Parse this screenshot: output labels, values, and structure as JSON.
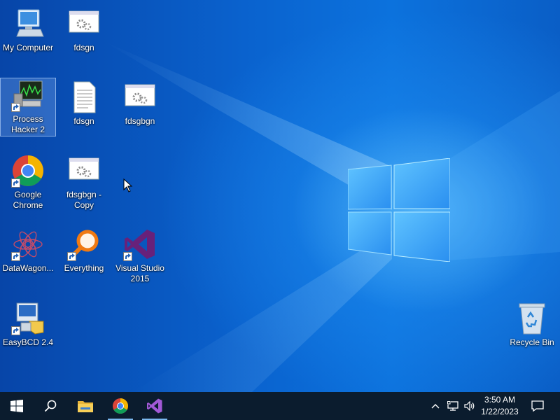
{
  "desktop": {
    "icons": [
      {
        "label": "My Computer",
        "icon": "computer-icon"
      },
      {
        "label": "fdsgn",
        "icon": "application-icon"
      },
      {
        "label": "Process Hacker 2",
        "icon": "process-hacker-icon"
      },
      {
        "label": "fdsgn",
        "icon": "document-icon"
      },
      {
        "label": "fdsgbgn",
        "icon": "application-icon"
      },
      {
        "label": "Google Chrome",
        "icon": "chrome-icon"
      },
      {
        "label": "fdsgbgn - Copy",
        "icon": "application-icon"
      },
      {
        "label": "DataWagon...",
        "icon": "datawagon-icon"
      },
      {
        "label": "Everything",
        "icon": "everything-icon"
      },
      {
        "label": "Visual Studio 2015",
        "icon": "visual-studio-icon"
      },
      {
        "label": "EasyBCD 2.4",
        "icon": "easybcd-icon"
      },
      {
        "label": "Recycle Bin",
        "icon": "recycle-bin-icon"
      }
    ],
    "selected_icon": "Process Hacker 2",
    "wallpaper_logo": "windows-logo"
  },
  "taskbar": {
    "start": "start-icon",
    "search": "search-icon",
    "pinned": [
      "file-explorer-icon",
      "chrome-icon",
      "visual-studio-icon"
    ],
    "tray": [
      "chevron-up-icon",
      "network-icon",
      "volume-icon"
    ],
    "clock": {
      "time": "3:50 AM",
      "date": "1/22/2023"
    },
    "notifications": "notification-icon"
  },
  "colors": {
    "taskbar": "#0b1c2e",
    "wallpaper": "#0a63cf",
    "accent": "#7cb8ee"
  }
}
